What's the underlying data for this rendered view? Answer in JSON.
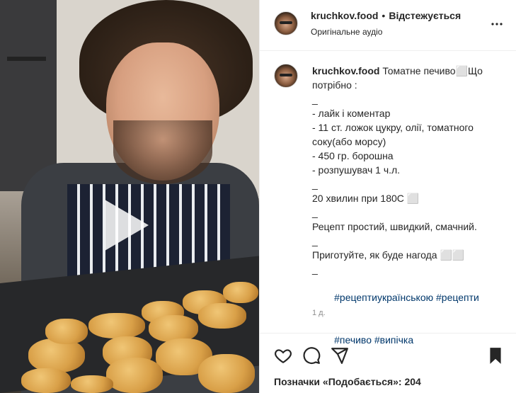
{
  "header": {
    "username": "kruchkov.food",
    "separator": "•",
    "follow_status": "Відстежується",
    "audio": "Оригінальне аудіо",
    "more_icon": "more-horizontal-icon"
  },
  "caption": {
    "username": "kruchkov.food",
    "lines": [
      "Томатне печиво⬜Що",
      "потрібно :",
      "_",
      "- лайк і коментар",
      "- 11 ст. ложок цукру, олії, томатного соку(або морсу)",
      "- 450 гр. борошна",
      "- розпушувач 1 ч.л.",
      "_",
      "20 хвилин при 180С ⬜",
      "_",
      "Рецепт простий, швидкий, смачний.",
      "_",
      "Приготуйте, як буде нагода ⬜⬜",
      "_"
    ],
    "tags": [
      "#рецептиукраїнською",
      "#рецепти",
      "#печиво",
      "#випічка"
    ],
    "time": "1 д."
  },
  "actions": {
    "like_icon": "heart-icon",
    "comment_icon": "comment-icon",
    "share_icon": "share-icon",
    "save_icon": "bookmark-icon"
  },
  "likes_text": "Позначки «Подобається»: 204",
  "media": {
    "play_icon": "play-icon"
  }
}
